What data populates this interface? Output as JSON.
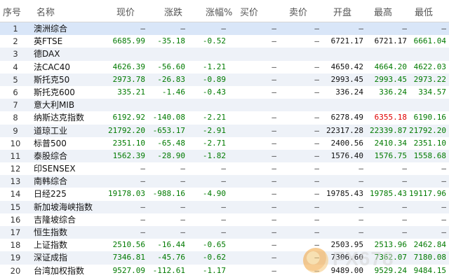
{
  "headers": [
    "序号",
    "名称",
    "现价",
    "涨跌",
    "涨幅%",
    "买价",
    "卖价",
    "开盘",
    "最高",
    "最低"
  ],
  "rows": [
    {
      "no": "1",
      "name": "澳洲综合",
      "price": "—",
      "chg": "—",
      "pct": "—",
      "bid": "—",
      "ask": "—",
      "open": "—",
      "high": "—",
      "low": "—",
      "dir": "none",
      "high_color": "black",
      "selected": true
    },
    {
      "no": "2",
      "name": "英FTSE",
      "price": "6685.99",
      "chg": "-35.18",
      "pct": "-0.52",
      "bid": "—",
      "ask": "—",
      "open": "6721.17",
      "high": "6721.17",
      "low": "6661.04",
      "dir": "down",
      "high_color": "black"
    },
    {
      "no": "3",
      "name": "德DAX",
      "price": "",
      "chg": "",
      "pct": "",
      "bid": "",
      "ask": "",
      "open": "",
      "high": "",
      "low": "",
      "dir": "none",
      "high_color": "black"
    },
    {
      "no": "4",
      "name": "法CAC40",
      "price": "4626.39",
      "chg": "-56.60",
      "pct": "-1.21",
      "bid": "—",
      "ask": "—",
      "open": "4650.42",
      "high": "4664.20",
      "low": "4622.03",
      "dir": "down",
      "high_color": "green"
    },
    {
      "no": "5",
      "name": "斯托克50",
      "price": "2973.78",
      "chg": "-26.83",
      "pct": "-0.89",
      "bid": "—",
      "ask": "—",
      "open": "2993.45",
      "high": "2993.45",
      "low": "2973.22",
      "dir": "down",
      "high_color": "green"
    },
    {
      "no": "6",
      "name": "斯托克600",
      "price": "335.21",
      "chg": "-1.46",
      "pct": "-0.43",
      "bid": "—",
      "ask": "—",
      "open": "336.24",
      "high": "336.24",
      "low": "334.57",
      "dir": "down",
      "high_color": "green"
    },
    {
      "no": "7",
      "name": "意大利MIB",
      "price": "",
      "chg": "",
      "pct": "",
      "bid": "",
      "ask": "",
      "open": "",
      "high": "",
      "low": "",
      "dir": "none",
      "high_color": "black"
    },
    {
      "no": "8",
      "name": "纳斯达克指数",
      "price": "6192.92",
      "chg": "-140.08",
      "pct": "-2.21",
      "bid": "—",
      "ask": "—",
      "open": "6278.49",
      "high": "6355.18",
      "low": "6190.16",
      "dir": "down",
      "high_color": "red"
    },
    {
      "no": "9",
      "name": "道琼工业",
      "price": "21792.20",
      "chg": "-653.17",
      "pct": "-2.91",
      "bid": "—",
      "ask": "—",
      "open": "22317.28",
      "high": "22339.87",
      "low": "21792.20",
      "dir": "down",
      "high_color": "green"
    },
    {
      "no": "10",
      "name": "标普500",
      "price": "2351.10",
      "chg": "-65.48",
      "pct": "-2.71",
      "bid": "—",
      "ask": "—",
      "open": "2400.56",
      "high": "2410.34",
      "low": "2351.10",
      "dir": "down",
      "high_color": "green"
    },
    {
      "no": "11",
      "name": "泰股综合",
      "price": "1562.39",
      "chg": "-28.90",
      "pct": "-1.82",
      "bid": "—",
      "ask": "—",
      "open": "1576.40",
      "high": "1576.75",
      "low": "1558.68",
      "dir": "down",
      "high_color": "green"
    },
    {
      "no": "12",
      "name": "印SENSEX",
      "price": "—",
      "chg": "—",
      "pct": "—",
      "bid": "—",
      "ask": "—",
      "open": "—",
      "high": "—",
      "low": "—",
      "dir": "none",
      "high_color": "black"
    },
    {
      "no": "13",
      "name": "南韩综合",
      "price": "—",
      "chg": "—",
      "pct": "—",
      "bid": "—",
      "ask": "—",
      "open": "—",
      "high": "—",
      "low": "—",
      "dir": "none",
      "high_color": "black"
    },
    {
      "no": "14",
      "name": "日经225",
      "price": "19178.03",
      "chg": "-988.16",
      "pct": "-4.90",
      "bid": "—",
      "ask": "—",
      "open": "19785.43",
      "high": "19785.43",
      "low": "19117.96",
      "dir": "down",
      "high_color": "green"
    },
    {
      "no": "15",
      "name": "新加坡海峡指数",
      "price": "—",
      "chg": "—",
      "pct": "—",
      "bid": "—",
      "ask": "—",
      "open": "—",
      "high": "—",
      "low": "—",
      "dir": "none",
      "high_color": "black"
    },
    {
      "no": "16",
      "name": "吉隆坡综合",
      "price": "—",
      "chg": "—",
      "pct": "—",
      "bid": "—",
      "ask": "—",
      "open": "—",
      "high": "—",
      "low": "—",
      "dir": "none",
      "high_color": "black"
    },
    {
      "no": "17",
      "name": "恒生指数",
      "price": "—",
      "chg": "—",
      "pct": "—",
      "bid": "—",
      "ask": "—",
      "open": "—",
      "high": "—",
      "low": "—",
      "dir": "none",
      "high_color": "black"
    },
    {
      "no": "18",
      "name": "上证指数",
      "price": "2510.56",
      "chg": "-16.44",
      "pct": "-0.65",
      "bid": "—",
      "ask": "—",
      "open": "2503.95",
      "high": "2513.96",
      "low": "2462.84",
      "dir": "down",
      "high_color": "green"
    },
    {
      "no": "19",
      "name": "深证成指",
      "price": "7346.81",
      "chg": "-45.76",
      "pct": "-0.62",
      "bid": "—",
      "ask": "—",
      "open": "7306.60",
      "high": "7362.07",
      "low": "7180.08",
      "dir": "down",
      "high_color": "green"
    },
    {
      "no": "20",
      "name": "台湾加权指数",
      "price": "9527.09",
      "chg": "-112.61",
      "pct": "-1.17",
      "bid": "—",
      "ask": "—",
      "open": "9489.00",
      "high": "9529.24",
      "low": "9484.15",
      "dir": "down",
      "high_color": "green"
    }
  ],
  "colors": {
    "down": "#007a00",
    "up": "#e00000",
    "neutral": "#111111",
    "selected_row": "#d9e6f8"
  },
  "watermark": {
    "text": "FX678",
    "icon": "fx678-logo-icon"
  }
}
